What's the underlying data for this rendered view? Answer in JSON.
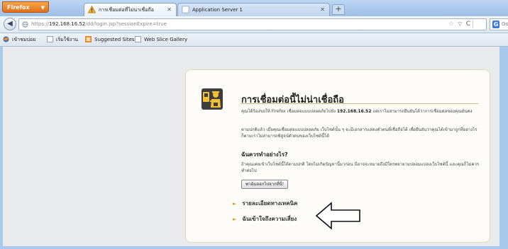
{
  "browser": {
    "menu_button": "Firefox",
    "tabs": [
      {
        "label": "การเชื่อมต่อที่ไม่น่าเชื่อถือ",
        "active": true
      },
      {
        "label": "Application Server 1",
        "active": false
      }
    ],
    "new_tab": "+",
    "url": {
      "prefix": "https://",
      "host": "192.168.16.52",
      "path": "/dd/login.jsp?sessionExpire=true"
    },
    "search_engine": "G",
    "search_placeholder": "Go"
  },
  "bookmarks": [
    {
      "label": "เข้าชมบ่อย"
    },
    {
      "label": "เริ่มใช้งาน"
    },
    {
      "label": "Suggested Sites"
    },
    {
      "label": "Web Slice Gallery"
    }
  ],
  "error_page": {
    "title": "การเชื่อมต่อนี้ไม่น่าเชื่อถือ",
    "paragraph1_pre": "คุณได้ร้องขอให้ Firefox เชื่อมต่อแบบปลอดภัยไปยัง ",
    "paragraph1_host": "192.168.16.52",
    "paragraph1_post": " แต่เราไม่สามารถยืนยันได้ว่าการเชื่อมต่อของคุณมั่นคง",
    "paragraph2": "ตามปกติแล้ว เมื่อคุณเชื่อมต่อแบบปลอดภัย เว็บไซต์นั้น ๆ จะมีเอกสารแสดงตัวตนที่เชื่อถือได้ เพื่อยืนยันว่าคุณได้เข้ามาถูกที่อย่างไรก็ตามเราไม่สามารถพิสูจน์ตัวตนของเว็บไซต์นี้ได้",
    "heading2": "ฉันควรทำอย่างไร?",
    "paragraph3": "ถ้าคุณเคยเข้าเว็บไซต์นี้ได้ตามปกติ โดยไม่เกิดปัญหานี้มาก่อน นี่อาจจะหมายถึงมีใครพยายามปลอมแปลงเว็บไซต์นี้ และคุณก็ไม่ควรทำต่อไป",
    "get_me_out_button": "พาฉันออกไปจากที่นี่!",
    "technical_details": "รายละเอียดทางเทคนิค",
    "understand_risks": "ฉันเข้าใจถึงความเสี่ยง"
  },
  "colors": {
    "accent_orange": "#e8891f",
    "frame_blue": "#a9c9ec",
    "page_background": "#e9eaeb",
    "card_background": "#fdfcf8"
  }
}
